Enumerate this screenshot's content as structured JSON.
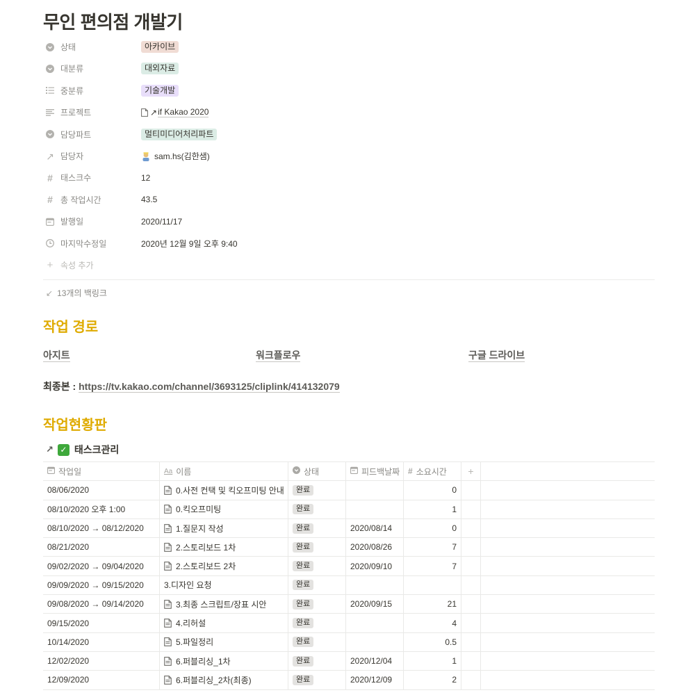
{
  "page": {
    "title": "무인 편의점 개발기"
  },
  "colors": {
    "heading": "#dfab01",
    "tag_status": "#f0dcd4",
    "tag_category": "#dbece5",
    "tag_mid": "#e8defa",
    "tag_part": "#dbece5"
  },
  "properties": {
    "status": {
      "label": "상태",
      "icon": "select-icon",
      "value": "아카이브"
    },
    "category": {
      "label": "대분류",
      "icon": "select-icon",
      "value": "대외자료"
    },
    "subcategory": {
      "label": "중분류",
      "icon": "list-icon",
      "value": "기술개발"
    },
    "project": {
      "label": "프로젝트",
      "icon": "text-icon",
      "value": "if Kakao 2020"
    },
    "part": {
      "label": "담당파트",
      "icon": "select-icon",
      "value": "멀티미디어처리파트"
    },
    "owner": {
      "label": "담당자",
      "icon": "relation-arrow-icon",
      "value": "sam.hs(김한샘)"
    },
    "task_count": {
      "label": "태스크수",
      "icon": "number-icon",
      "value": "12"
    },
    "total_hours": {
      "label": "총 작업시간",
      "icon": "number-icon",
      "value": "43.5"
    },
    "published": {
      "label": "발행일",
      "icon": "calendar-icon",
      "value": "2020/11/17"
    },
    "last_edited": {
      "label": "마지막수정일",
      "icon": "clock-icon",
      "value": "2020년 12월 9일 오후 9:40"
    },
    "add_property": {
      "label": "속성 추가"
    }
  },
  "backlinks": {
    "label": "13개의 백링크"
  },
  "section_path": {
    "heading": "작업 경로",
    "links": [
      "아지트",
      "워크플로우",
      "구글 드라이브"
    ],
    "final_label": "최종본 : ",
    "final_url": "https://tv.kakao.com/channel/3693125/cliplink/414132079"
  },
  "section_board": {
    "heading": "작업현황판",
    "db_title": "태스크관리",
    "columns": [
      "작업일",
      "이름",
      "상태",
      "피드백날짜",
      "소요시간"
    ],
    "rows": [
      {
        "date": "08/06/2020",
        "name": "0.사전 컨택 및 킥오프미팅 안내",
        "doc": true,
        "status": "완료",
        "feedback": "",
        "hours": "0"
      },
      {
        "date": "08/10/2020 오후 1:00",
        "name": "0.킥오프미팅",
        "doc": true,
        "status": "완료",
        "feedback": "",
        "hours": "1"
      },
      {
        "date": "08/10/2020 → 08/12/2020",
        "name": "1.질문지 작성",
        "doc": true,
        "status": "완료",
        "feedback": "2020/08/14",
        "hours": "0"
      },
      {
        "date": "08/21/2020",
        "name": "2.스토리보드 1차",
        "doc": true,
        "status": "완료",
        "feedback": "2020/08/26",
        "hours": "7"
      },
      {
        "date": "09/02/2020 → 09/04/2020",
        "name": "2.스토리보드 2차",
        "doc": true,
        "status": "완료",
        "feedback": "2020/09/10",
        "hours": "7"
      },
      {
        "date": "09/09/2020 → 09/15/2020",
        "name": "3.디자인 요청",
        "doc": false,
        "status": "완료",
        "feedback": "",
        "hours": ""
      },
      {
        "date": "09/08/2020 → 09/14/2020",
        "name": "3.최종 스크립트/장표 시안",
        "doc": true,
        "status": "완료",
        "feedback": "2020/09/15",
        "hours": "21"
      },
      {
        "date": "09/15/2020",
        "name": "4.리허설",
        "doc": true,
        "status": "완료",
        "feedback": "",
        "hours": "4"
      },
      {
        "date": "10/14/2020",
        "name": "5.파일정리",
        "doc": true,
        "status": "완료",
        "feedback": "",
        "hours": "0.5"
      },
      {
        "date": "12/02/2020",
        "name": "6.퍼블리싱_1차",
        "doc": true,
        "status": "완료",
        "feedback": "2020/12/04",
        "hours": "1"
      },
      {
        "date": "12/09/2020",
        "name": "6.퍼블리싱_2차(최종)",
        "doc": true,
        "status": "완료",
        "feedback": "2020/12/09",
        "hours": "2"
      }
    ]
  }
}
